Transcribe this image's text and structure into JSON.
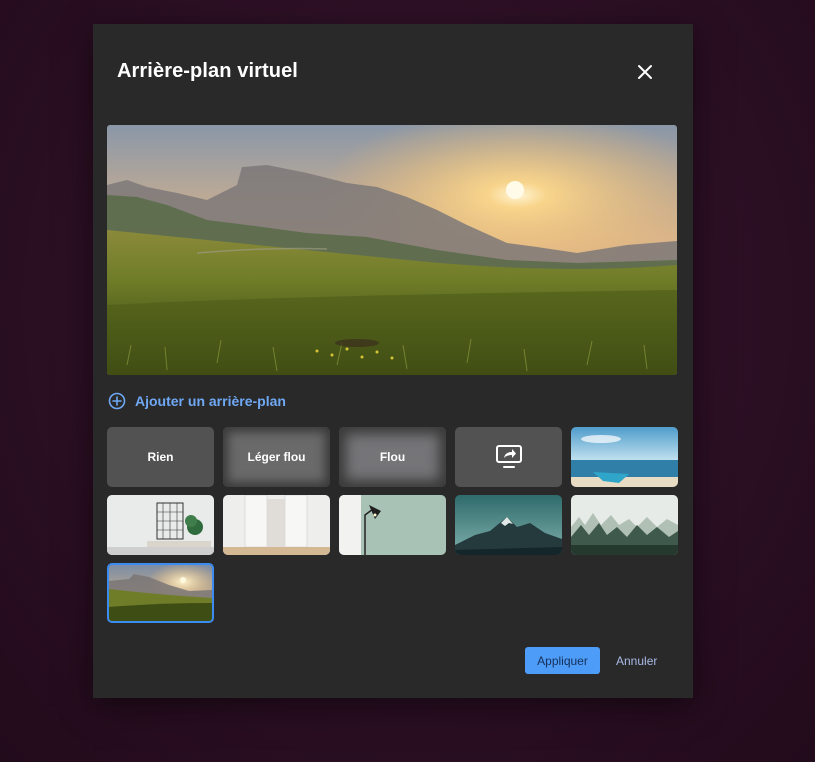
{
  "dialog": {
    "title": "Arrière-plan virtuel",
    "close_icon": "close-icon"
  },
  "add_background": {
    "icon": "plus-circle-icon",
    "label": "Ajouter un arrière-plan"
  },
  "backgrounds": {
    "none_label": "Rien",
    "light_blur_label": "Léger flou",
    "blur_label": "Flou",
    "share_screen_icon": "share-screen-icon",
    "images": [
      "beach",
      "white-room",
      "white-doors",
      "floor-lamp",
      "mountain-peak",
      "misty-forest",
      "meadow-sunset"
    ],
    "selected": "meadow-sunset"
  },
  "footer": {
    "apply_label": "Appliquer",
    "cancel_label": "Annuler"
  },
  "colors": {
    "dialog_bg": "#292929",
    "accent": "#4d9cf8",
    "link": "#6fa8f5",
    "selected_border": "#3b8bf0"
  }
}
